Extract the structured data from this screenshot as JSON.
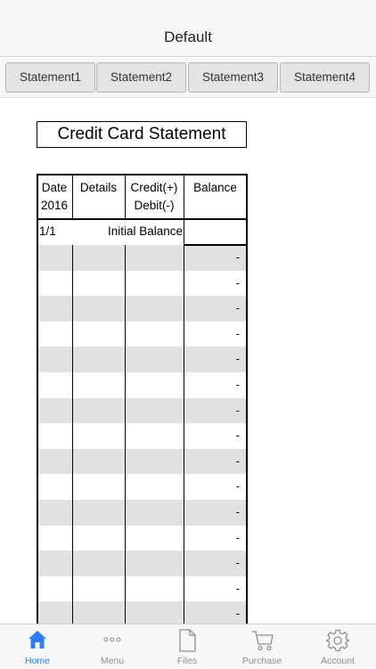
{
  "nav": {
    "title": "Default"
  },
  "segments": [
    "Statement1",
    "Statement2",
    "Statement3",
    "Statement4"
  ],
  "document": {
    "title": "Credit Card Statement"
  },
  "table": {
    "headers": {
      "date": [
        "Date",
        "2016"
      ],
      "details": [
        "Details"
      ],
      "credit_debit": [
        "Credit(+)",
        "Debit(-)"
      ],
      "balance": [
        "Balance"
      ]
    },
    "initial_row": {
      "date": "1/1",
      "label": "Initial Balance"
    },
    "empty_balance": "-",
    "empty_row_count": 15
  },
  "tabs": [
    {
      "label": "Home",
      "icon": "home-icon",
      "active": true
    },
    {
      "label": "Menu",
      "icon": "more-dots-icon",
      "active": false
    },
    {
      "label": "Files",
      "icon": "file-icon",
      "active": false
    },
    {
      "label": "Purchase",
      "icon": "cart-icon",
      "active": false
    },
    {
      "label": "Account",
      "icon": "gear-icon",
      "active": false
    }
  ],
  "colors": {
    "accent": "#2d7cf6",
    "row_stripe": "#e1e1e1"
  }
}
